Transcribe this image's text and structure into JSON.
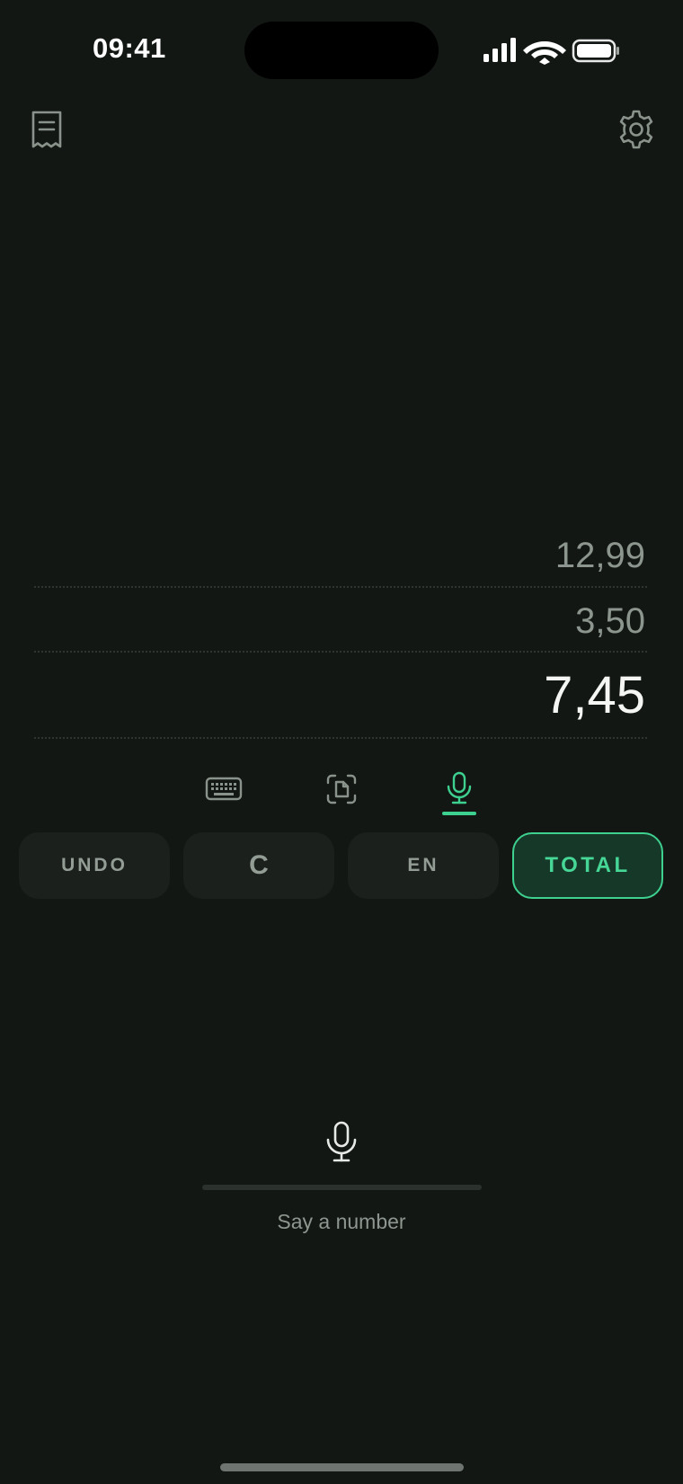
{
  "status_bar": {
    "time": "09:41"
  },
  "tape": {
    "entries": [
      "12,99",
      "3,50"
    ],
    "current": "7,45"
  },
  "mode_tabs": [
    {
      "icon": "keyboard-icon",
      "active": false
    },
    {
      "icon": "scan-document-icon",
      "active": false
    },
    {
      "icon": "microphone-icon",
      "active": true
    }
  ],
  "actions": {
    "undo": "UNDO",
    "clear": "C",
    "language": "EN",
    "total": "TOTAL"
  },
  "voice": {
    "hint": "Say a number",
    "level": 0
  },
  "colors": {
    "background": "#131714",
    "accent": "#3dd08f",
    "button": "#1b201c",
    "muted_text": "#8c958e"
  }
}
